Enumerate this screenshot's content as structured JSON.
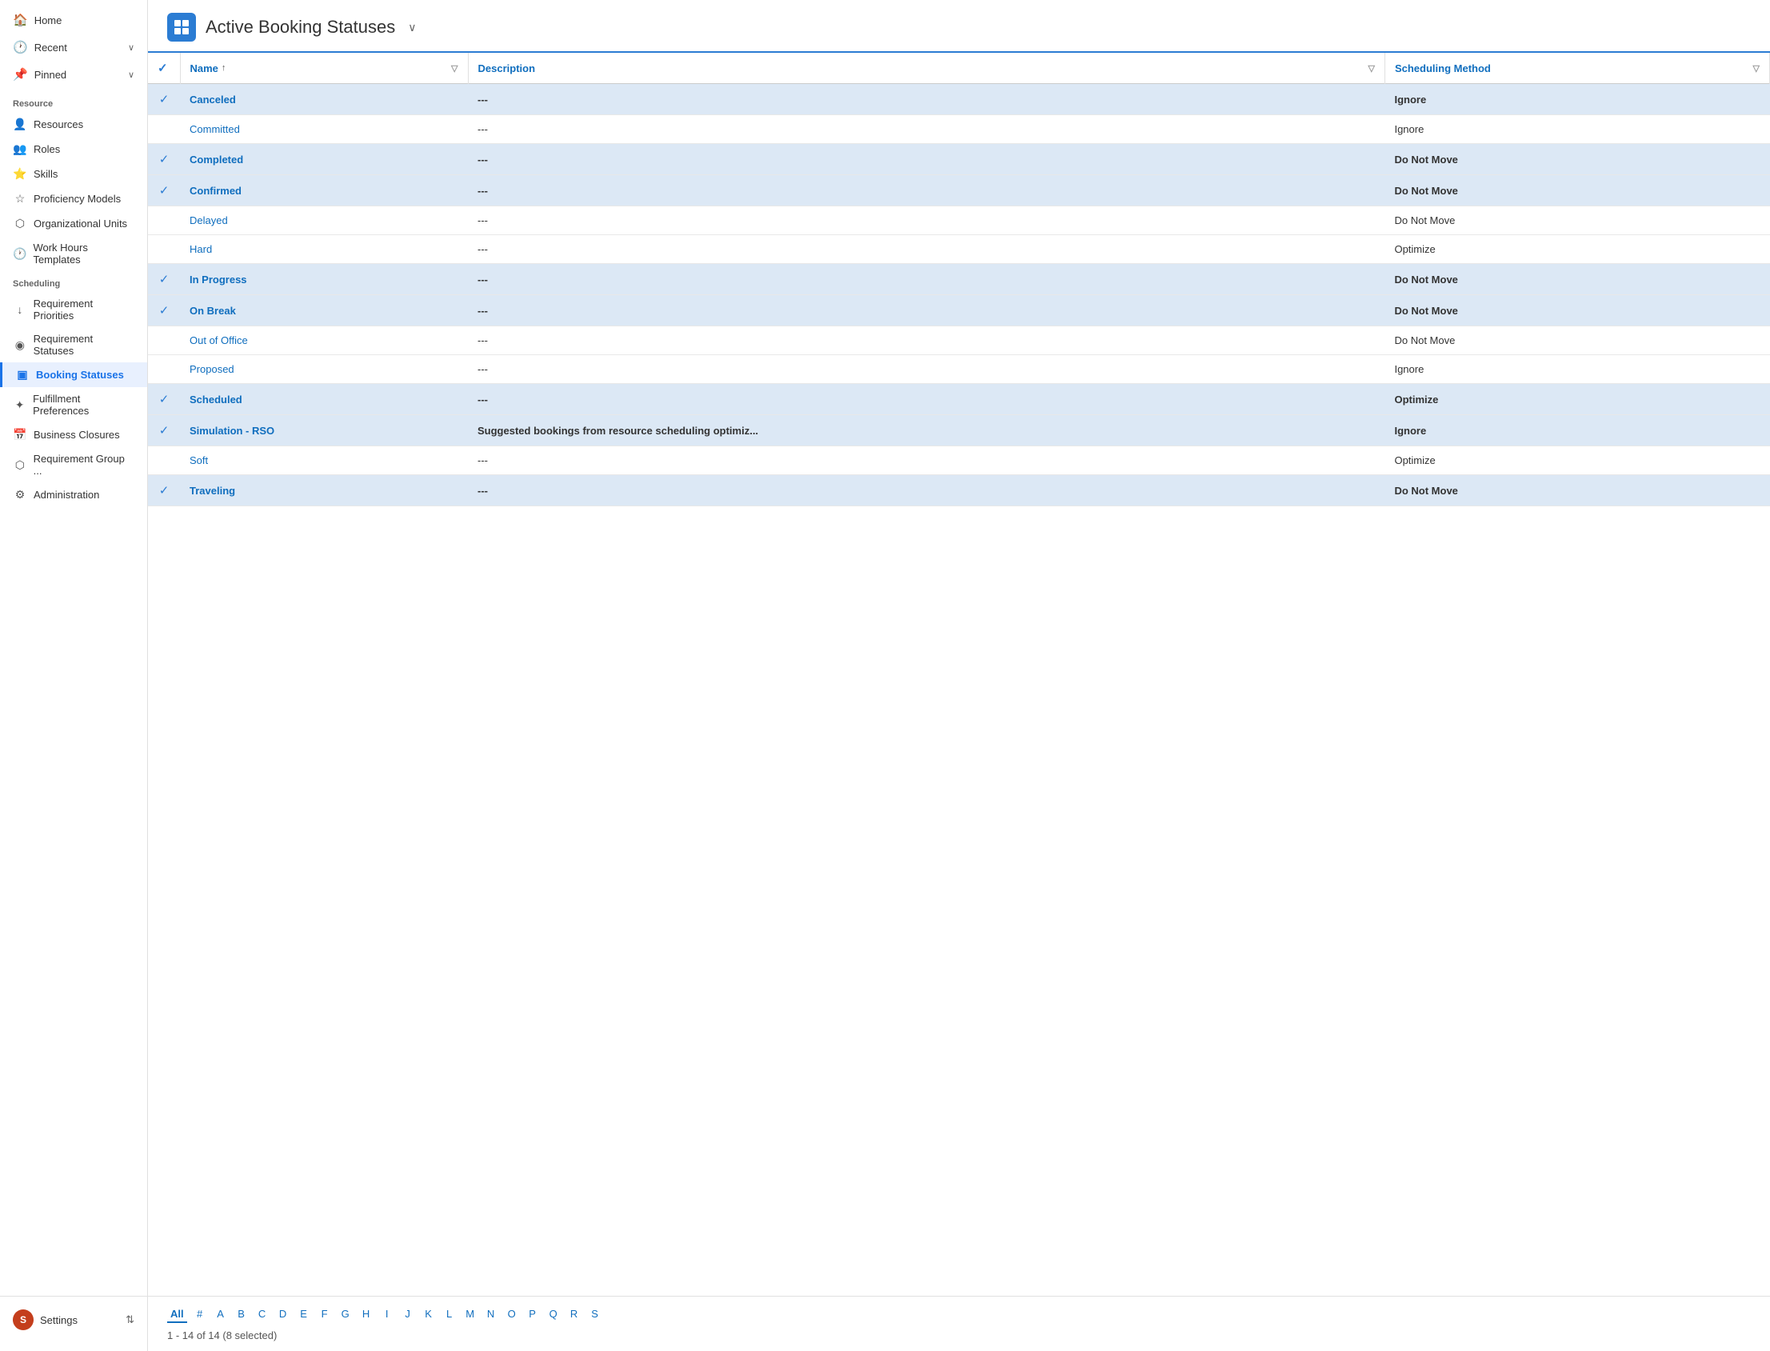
{
  "sidebar": {
    "top_nav": [
      {
        "label": "Home",
        "icon": "🏠",
        "id": "home"
      },
      {
        "label": "Recent",
        "icon": "🕐",
        "id": "recent",
        "hasChevron": true
      },
      {
        "label": "Pinned",
        "icon": "📌",
        "id": "pinned",
        "hasChevron": true
      }
    ],
    "sections": [
      {
        "label": "Resource",
        "items": [
          {
            "label": "Resources",
            "icon": "👤",
            "id": "resources"
          },
          {
            "label": "Roles",
            "icon": "👥",
            "id": "roles"
          },
          {
            "label": "Skills",
            "icon": "⭐",
            "id": "skills"
          },
          {
            "label": "Proficiency Models",
            "icon": "☆",
            "id": "proficiency-models"
          },
          {
            "label": "Organizational Units",
            "icon": "⬡",
            "id": "org-units"
          },
          {
            "label": "Work Hours Templates",
            "icon": "🕐",
            "id": "work-hours"
          }
        ]
      },
      {
        "label": "Scheduling",
        "items": [
          {
            "label": "Requirement Priorities",
            "icon": "↓",
            "id": "req-priorities"
          },
          {
            "label": "Requirement Statuses",
            "icon": "◉",
            "id": "req-statuses"
          },
          {
            "label": "Booking Statuses",
            "icon": "▣",
            "id": "booking-statuses",
            "active": true
          },
          {
            "label": "Fulfillment Preferences",
            "icon": "✦",
            "id": "fulfillment-prefs"
          },
          {
            "label": "Business Closures",
            "icon": "📅",
            "id": "business-closures"
          },
          {
            "label": "Requirement Group ...",
            "icon": "⬡",
            "id": "req-group"
          },
          {
            "label": "Administration",
            "icon": "⚙",
            "id": "administration"
          }
        ]
      }
    ],
    "bottom": {
      "label": "Settings",
      "avatar": "S",
      "chevron": "⇅"
    }
  },
  "header": {
    "app_icon": "▣",
    "title": "Active Booking Statuses",
    "chevron": "∨"
  },
  "table": {
    "columns": [
      {
        "id": "check",
        "label": "✓",
        "sortable": false,
        "filterable": false
      },
      {
        "id": "name",
        "label": "Name",
        "sortable": true,
        "filterable": true
      },
      {
        "id": "description",
        "label": "Description",
        "sortable": false,
        "filterable": true
      },
      {
        "id": "scheduling_method",
        "label": "Scheduling Method",
        "sortable": false,
        "filterable": true
      }
    ],
    "rows": [
      {
        "id": 1,
        "selected": true,
        "name": "Canceled",
        "description": "---",
        "scheduling_method": "Ignore"
      },
      {
        "id": 2,
        "selected": false,
        "name": "Committed",
        "description": "---",
        "scheduling_method": "Ignore"
      },
      {
        "id": 3,
        "selected": true,
        "name": "Completed",
        "description": "---",
        "scheduling_method": "Do Not Move"
      },
      {
        "id": 4,
        "selected": true,
        "name": "Confirmed",
        "description": "---",
        "scheduling_method": "Do Not Move"
      },
      {
        "id": 5,
        "selected": false,
        "name": "Delayed",
        "description": "---",
        "scheduling_method": "Do Not Move"
      },
      {
        "id": 6,
        "selected": false,
        "name": "Hard",
        "description": "---",
        "scheduling_method": "Optimize"
      },
      {
        "id": 7,
        "selected": true,
        "name": "In Progress",
        "description": "---",
        "scheduling_method": "Do Not Move"
      },
      {
        "id": 8,
        "selected": true,
        "name": "On Break",
        "description": "---",
        "scheduling_method": "Do Not Move"
      },
      {
        "id": 9,
        "selected": false,
        "name": "Out of Office",
        "description": "---",
        "scheduling_method": "Do Not Move"
      },
      {
        "id": 10,
        "selected": false,
        "name": "Proposed",
        "description": "---",
        "scheduling_method": "Ignore"
      },
      {
        "id": 11,
        "selected": true,
        "name": "Scheduled",
        "description": "---",
        "scheduling_method": "Optimize"
      },
      {
        "id": 12,
        "selected": true,
        "name": "Simulation - RSO",
        "description": "Suggested bookings from resource scheduling optimiz...",
        "scheduling_method": "Ignore"
      },
      {
        "id": 13,
        "selected": false,
        "name": "Soft",
        "description": "---",
        "scheduling_method": "Optimize"
      },
      {
        "id": 14,
        "selected": true,
        "name": "Traveling",
        "description": "---",
        "scheduling_method": "Do Not Move"
      }
    ]
  },
  "pagination": {
    "alpha_items": [
      "All",
      "#",
      "A",
      "B",
      "C",
      "D",
      "E",
      "F",
      "G",
      "H",
      "I",
      "J",
      "K",
      "L",
      "M",
      "N",
      "O",
      "P",
      "Q",
      "R",
      "S"
    ],
    "active_alpha": "All",
    "info": "1 - 14 of 14 (8 selected)"
  }
}
